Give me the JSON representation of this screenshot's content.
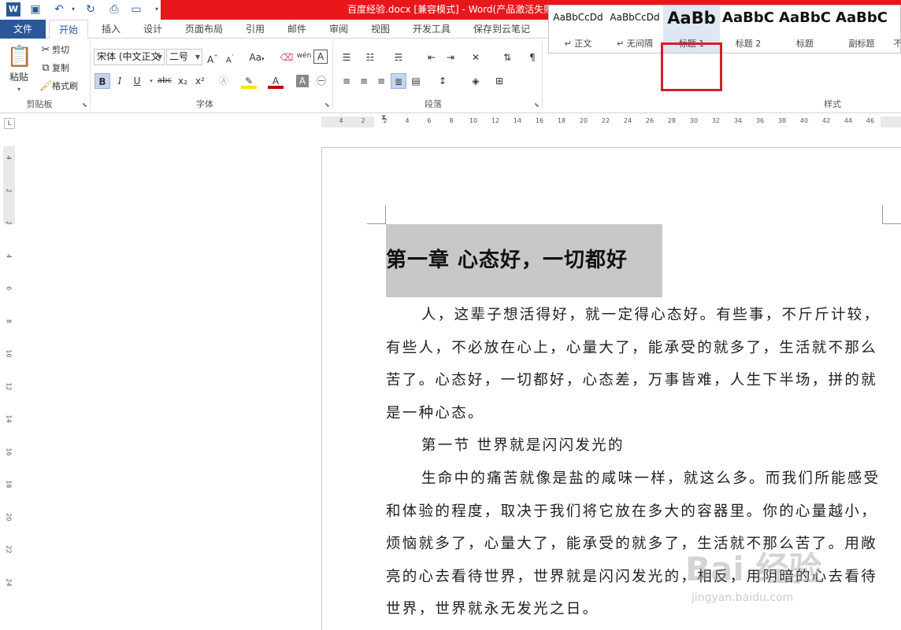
{
  "window": {
    "title": "百度经验.docx [兼容模式] - Word(产品激活失败)"
  },
  "quick_access": [
    {
      "name": "word-logo-icon",
      "glyph": "W"
    },
    {
      "name": "save-icon",
      "glyph": "💾"
    },
    {
      "name": "undo-icon",
      "glyph": "↶"
    },
    {
      "name": "redo-icon",
      "glyph": "↻"
    },
    {
      "name": "print-preview-icon",
      "glyph": "🔍"
    },
    {
      "name": "new-document-icon",
      "glyph": "▢"
    }
  ],
  "tabs": [
    "文件",
    "开始",
    "插入",
    "设计",
    "页面布局",
    "引用",
    "邮件",
    "审阅",
    "视图",
    "开发工具",
    "保存到云笔记"
  ],
  "clipboard": {
    "paste": "粘贴",
    "cut": "剪切",
    "copy": "复制",
    "format_painter": "格式刷",
    "group": "剪贴板"
  },
  "font": {
    "name": "宋体 (中文正文",
    "size": "二号",
    "group": "字体",
    "change_case": "Aa",
    "bold": "B",
    "italic": "I",
    "underline": "U",
    "strikethrough": "abc",
    "subscript": "x₂",
    "superscript": "x²",
    "phonetic": "wén"
  },
  "paragraph": {
    "group": "段落"
  },
  "styles": {
    "group": "样式",
    "items": [
      {
        "preview": "AaBbCcDd",
        "name": "正文"
      },
      {
        "preview": "AaBbCcDd",
        "name": "无间隔"
      },
      {
        "preview": "AaBb",
        "name": "标题 1"
      },
      {
        "preview": "AaBbC",
        "name": "标题 2"
      },
      {
        "preview": "AaBbC",
        "name": "标题"
      },
      {
        "preview": "AaBbC",
        "name": "副标题"
      },
      {
        "preview": "",
        "name": "不"
      }
    ],
    "selected": "标题 1"
  },
  "ruler": {
    "h_ticks": [
      "4",
      "2",
      "2",
      "4",
      "6",
      "8",
      "10",
      "12",
      "14",
      "16",
      "18",
      "20",
      "22",
      "24",
      "26",
      "28",
      "30",
      "32",
      "34",
      "36",
      "38",
      "40",
      "42",
      "44",
      "46"
    ],
    "v_ticks": [
      "4",
      "2",
      "2",
      "4",
      "6",
      "8",
      "10",
      "12",
      "14",
      "16",
      "18",
      "20",
      "22",
      "24"
    ]
  },
  "document": {
    "heading": "第一章  心态好，一切都好",
    "paragraphs": [
      "人，这辈子想活得好，就一定得心态好。有些事，不斤斤计较，有些人，不必放在心上，心量大了，能承受的就多了，生活就不那么苦了。心态好，一切都好，心态差，万事皆难，人生下半场，拼的就是一种心态。",
      "第一节  世界就是闪闪发光的",
      "生命中的痛苦就像是盐的咸味一样，就这么多。而我们所能感受和体验的程度，取决于我们将它放在多大的容器里。你的心量越小，烦恼就多了，心量大了，能承受的就多了，生活就不那么苦了。用敞亮的心去看待世界，世界就是闪闪发光的，相反，用阴暗的心去看待世界，世界就永无发光之日。"
    ]
  },
  "watermark": {
    "text": "Bai 经验",
    "url": "jingyan.baidu.com"
  }
}
